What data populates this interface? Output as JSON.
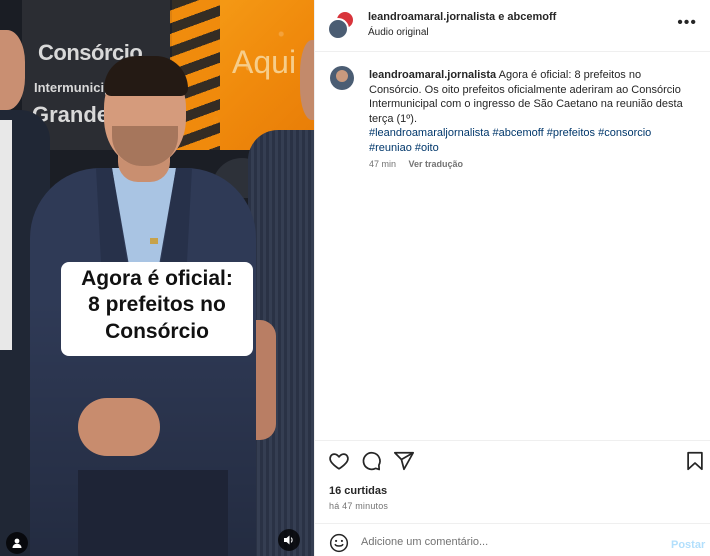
{
  "media": {
    "caption_line1": "Agora é oficial:",
    "caption_line2": "8 prefeitos no",
    "caption_line3": "Consórcio",
    "banner_line1": "Consórcio",
    "banner_line2": "Intermunicipal",
    "banner_line3": "Grande",
    "banner_right": "Aqui",
    "icons": {
      "user_tag": "person-icon",
      "audio": "speaker-icon"
    }
  },
  "header": {
    "username": "leandroamaral.jornalista e abcemoff",
    "subtitle": "Áudio original",
    "more_icon": "more-horizontal-icon"
  },
  "comment": {
    "username": "leandroamaral.jornalista",
    "text": "Agora é oficial: 8 prefeitos no Consórcio. Os oito prefeitos oficialmente aderiram ao Consórcio Intermunicipal com o ingresso de São Caetano na reunião desta terça (1º).",
    "hashtags": "#leandroamaraljornalista #abcemoff #prefeitos #consorcio #reuniao #oito",
    "time": "47 min",
    "translate_label": "Ver tradução"
  },
  "actions": {
    "likes": "16 curtidas",
    "posted": "há 47 minutos",
    "icons": [
      "heart-icon",
      "comment-icon",
      "share-icon",
      "bookmark-icon"
    ]
  },
  "composer": {
    "placeholder": "Adicione um comentário...",
    "post_label": "Postar"
  },
  "colors": {
    "link": "#00376b",
    "muted": "#737373",
    "post_disabled": "#b2dffc"
  }
}
